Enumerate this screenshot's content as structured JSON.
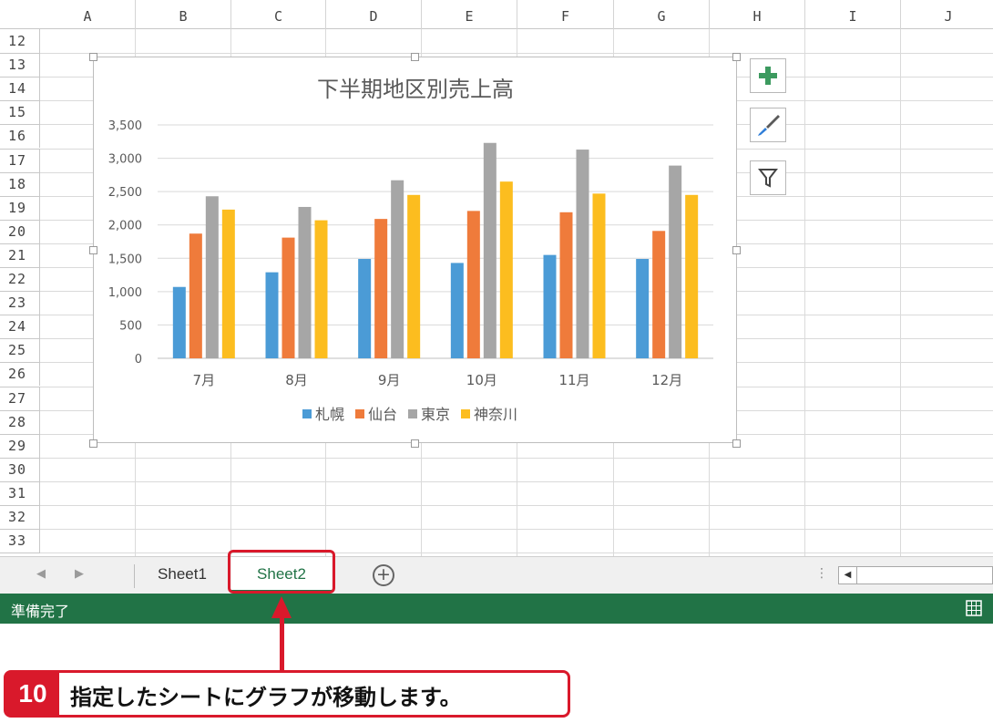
{
  "sheet": {
    "columns": [
      "A",
      "B",
      "C",
      "D",
      "E",
      "F",
      "G",
      "H",
      "I",
      "J"
    ],
    "rows": [
      "12",
      "13",
      "14",
      "15",
      "16",
      "17",
      "18",
      "19",
      "20",
      "21",
      "22",
      "23",
      "24",
      "25",
      "26",
      "27",
      "28",
      "29",
      "30",
      "31",
      "32",
      "33"
    ]
  },
  "chart_data": {
    "type": "bar",
    "title": "下半期地区別売上高",
    "categories": [
      "7月",
      "8月",
      "9月",
      "10月",
      "11月",
      "12月"
    ],
    "ylim": [
      0,
      3500
    ],
    "yticks": [
      "0",
      "500",
      "1,000",
      "1,500",
      "2,000",
      "2,500",
      "3,000",
      "3,500"
    ],
    "grid": true,
    "legend_position": "bottom",
    "series": [
      {
        "name": "札幌",
        "color": "#4b9bd6",
        "values": [
          1070,
          1290,
          1490,
          1430,
          1550,
          1490
        ]
      },
      {
        "name": "仙台",
        "color": "#ef7b3b",
        "values": [
          1870,
          1810,
          2090,
          2210,
          2190,
          1910
        ]
      },
      {
        "name": "東京",
        "color": "#a6a6a6",
        "values": [
          2430,
          2270,
          2670,
          3230,
          3130,
          2890
        ]
      },
      {
        "name": "神奈川",
        "color": "#fcbd1f",
        "values": [
          2230,
          2070,
          2450,
          2650,
          2470,
          2450
        ]
      }
    ]
  },
  "chart_tools": {
    "add_icon": "plus-icon",
    "style_icon": "brush-icon",
    "filter_icon": "filter-icon"
  },
  "tabs": {
    "sheet1": "Sheet1",
    "sheet2": "Sheet2",
    "active": "Sheet2"
  },
  "status": {
    "text": "準備完了"
  },
  "annotation": {
    "step": "10",
    "text": "指定したシートにグラフが移動します。",
    "accent": "#d9192b"
  },
  "colors": {
    "status_bar": "#217346",
    "active_tab_text": "#217346"
  }
}
